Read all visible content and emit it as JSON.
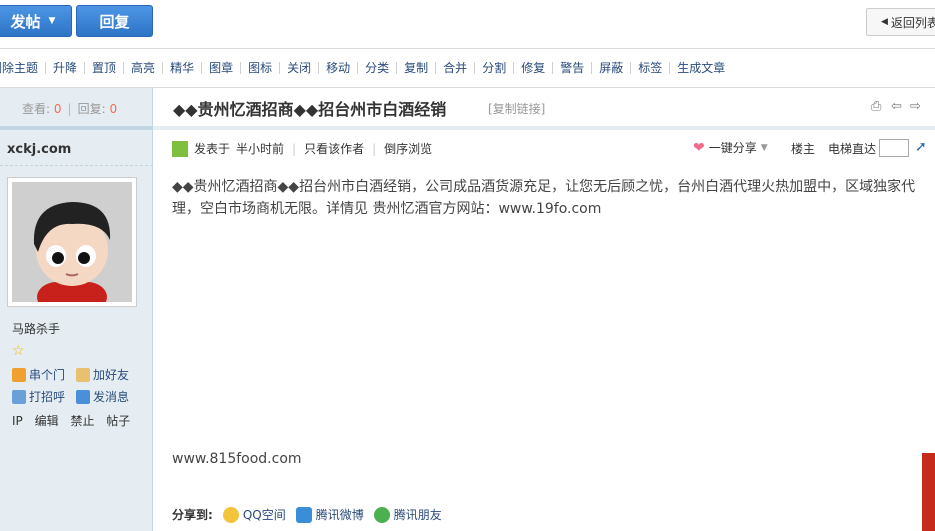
{
  "toolbar": {
    "post_label": "发帖",
    "reply_label": "回复",
    "back_label": "返回列表"
  },
  "modbar": [
    "删除主题",
    "升降",
    "置顶",
    "高亮",
    "精华",
    "图章",
    "图标",
    "关闭",
    "移动",
    "分类",
    "复制",
    "合并",
    "分割",
    "修复",
    "警告",
    "屏蔽",
    "标签",
    "生成文章"
  ],
  "stats": {
    "views_label": "查看:",
    "views": "0",
    "replies_label": "回复:",
    "replies": "0"
  },
  "thread": {
    "title": "◆◆贵州忆酒招商◆◆招台州市白酒经销",
    "copy_link": "[复制链接]"
  },
  "author": {
    "name_top": "xckj.com",
    "name": "马路杀手",
    "actions": [
      "串个门",
      "加好友",
      "打招呼",
      "发消息"
    ],
    "admin": [
      "IP",
      "编辑",
      "禁止",
      "帖子"
    ]
  },
  "meta": {
    "posted_prefix": "发表于",
    "posted_time": "半小时前",
    "only_author": "只看该作者",
    "reverse": "倒序浏览",
    "share_one": "一键分享",
    "floor": "楼主",
    "elevator": "电梯直达"
  },
  "post": {
    "body": "◆◆贵州忆酒招商◆◆招台州市白酒经销，公司成品酒货源充足，让您无后顾之忧，台州白酒代理火热加盟中，区域独家代理，空白市场商机无限。详情见 贵州忆酒官方网站：www.19fo.com",
    "footer_url": "www.815food.com"
  },
  "share": {
    "label": "分享到:",
    "targets": [
      "QQ空间",
      "腾讯微博",
      "腾讯朋友"
    ]
  }
}
